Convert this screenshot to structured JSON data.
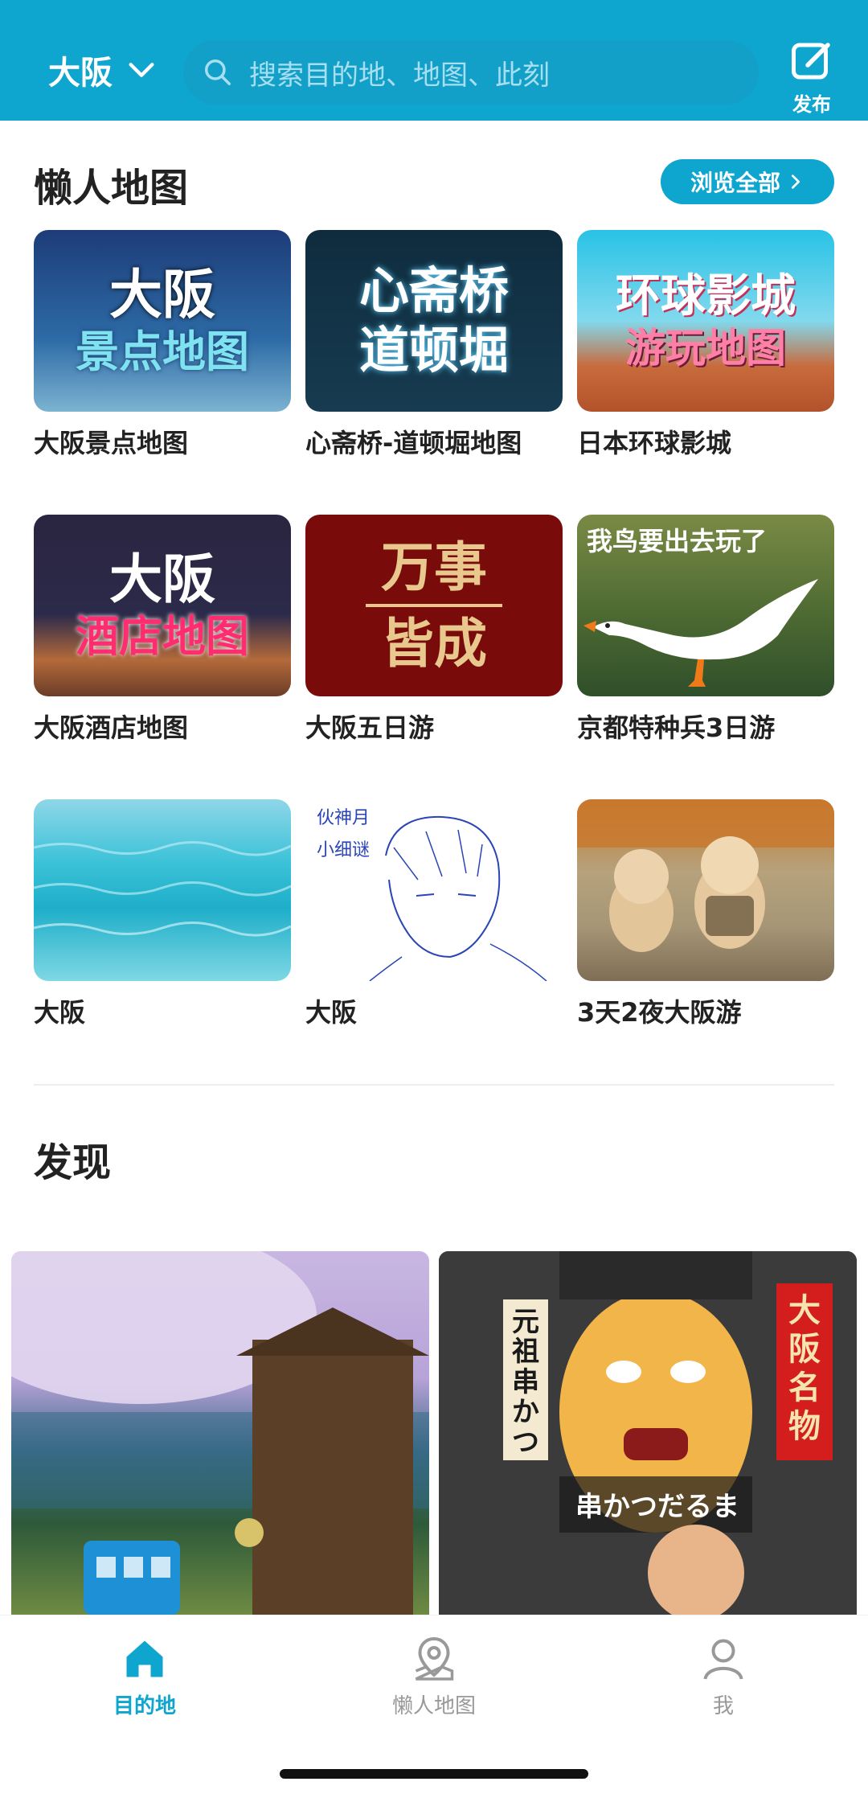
{
  "header": {
    "city": "大阪",
    "search_placeholder": "搜索目的地、地图、此刻",
    "publish_label": "发布",
    "bg_color": "#0ea5cf"
  },
  "lazy_maps": {
    "title": "懒人地图",
    "browse_all": "浏览全部",
    "items": [
      {
        "caption": "大阪景点地图",
        "thumb_line1": "大阪",
        "thumb_line2": "景点地图"
      },
      {
        "caption": "心斋桥-道顿堀地图",
        "thumb_line1": "心斋桥",
        "thumb_line2": "道顿堀"
      },
      {
        "caption": "日本环球影城",
        "thumb_line1": "环球影城",
        "thumb_line2": "游玩地图"
      },
      {
        "caption": "大阪酒店地图",
        "thumb_line1": "大阪",
        "thumb_line2": "酒店地图"
      },
      {
        "caption": "大阪五日游",
        "thumb_line1": "万事",
        "thumb_line2": "皆成"
      },
      {
        "caption": "京都特种兵3日游",
        "thumb_line1": "我鸟要出去玩了"
      },
      {
        "caption": "大阪"
      },
      {
        "caption": "大阪",
        "thumb_line1": "伙神月",
        "thumb_line2": "小细谜"
      },
      {
        "caption": "3天2夜大阪游"
      }
    ]
  },
  "discover": {
    "title": "发现",
    "card2_sign_left": "元祖串かつ",
    "card2_sign_right": "大阪名物",
    "card2_banner": "串かつだるま"
  },
  "tabbar": {
    "tabs": [
      {
        "label": "目的地",
        "icon": "home-icon",
        "active": true
      },
      {
        "label": "懒人地图",
        "icon": "map-pin-icon",
        "active": false
      },
      {
        "label": "我",
        "icon": "user-icon",
        "active": false
      }
    ],
    "active_color": "#0ea5cf"
  }
}
